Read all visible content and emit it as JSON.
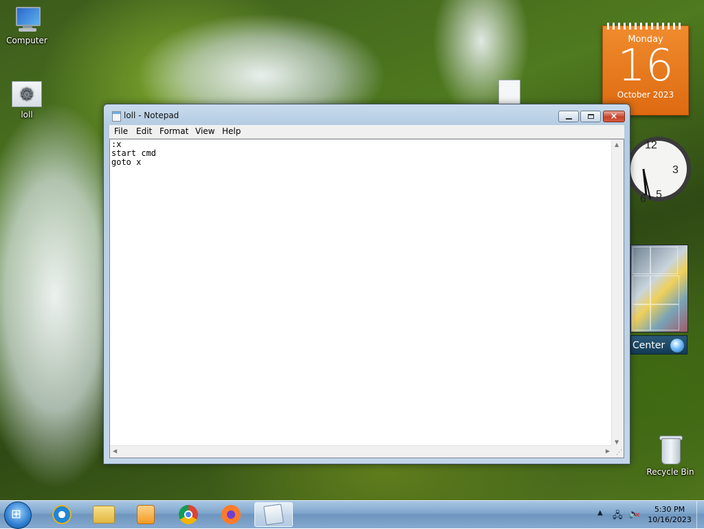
{
  "desktop": {
    "icons": [
      {
        "label": "Computer",
        "icon": "computer-icon"
      },
      {
        "label": "loll",
        "icon": "settings-file-icon"
      },
      {
        "label": "Recycle Bin",
        "icon": "recycle-bin-icon"
      }
    ],
    "gadgets": {
      "calendar": {
        "day_name": "Monday",
        "day_number": "16",
        "month_year": "October 2023",
        "color": "#e8791c"
      },
      "clock": {
        "numerals": [
          "12",
          "3",
          "5",
          "6"
        ]
      },
      "media_center": {
        "label": "Center"
      }
    }
  },
  "window": {
    "title": "loll - Notepad",
    "menu": [
      "File",
      "Edit",
      "Format",
      "View",
      "Help"
    ],
    "content": ":x\nstart cmd\ngoto x",
    "controls": {
      "minimize": "minimize",
      "maximize": "maximize",
      "close": "×"
    }
  },
  "taskbar": {
    "start_symbol": "⊞",
    "apps": [
      {
        "name": "internet-explorer",
        "active": false
      },
      {
        "name": "windows-explorer",
        "active": false
      },
      {
        "name": "media-player",
        "active": false
      },
      {
        "name": "chrome",
        "active": false
      },
      {
        "name": "firefox",
        "active": false
      },
      {
        "name": "notepad",
        "active": true
      }
    ],
    "time": "5:30 PM",
    "date": "10/16/2023"
  }
}
